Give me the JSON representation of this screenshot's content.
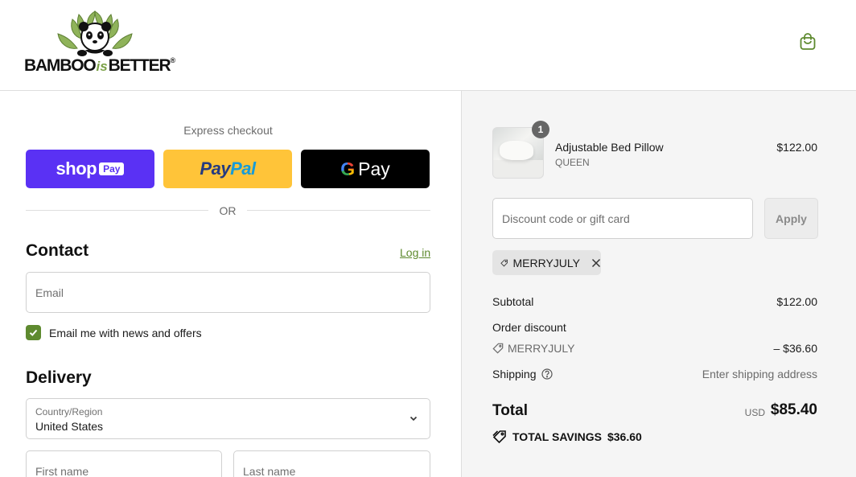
{
  "brand": {
    "name_part1": "BAMBOO",
    "name_part2": "is",
    "name_part3": "BETTER",
    "reg": "®"
  },
  "express": {
    "title": "Express checkout",
    "shop_label": "shop",
    "shop_pay_label": "Pay",
    "paypal_part1": "Pay",
    "paypal_part2": "Pal",
    "gpay_g": "G",
    "gpay_label": "Pay",
    "or_label": "OR"
  },
  "contact": {
    "title": "Contact",
    "login_label": "Log in",
    "email_placeholder": "Email",
    "newsletter_label": "Email me with news and offers",
    "newsletter_checked": true
  },
  "delivery": {
    "title": "Delivery",
    "country_label": "Country/Region",
    "country_value": "United States",
    "first_name_placeholder": "First name",
    "last_name_placeholder": "Last name"
  },
  "summary": {
    "item": {
      "quantity": "1",
      "name": "Adjustable Bed Pillow",
      "variant": "QUEEN",
      "price": "$122.00"
    },
    "discount_placeholder": "Discount code or gift card",
    "apply_label": "Apply",
    "applied_code": "MERRYJULY",
    "subtotal_label": "Subtotal",
    "subtotal_value": "$122.00",
    "order_discount_label": "Order discount",
    "order_discount_code": "MERRYJULY",
    "order_discount_value": "– $36.60",
    "shipping_label": "Shipping",
    "shipping_value": "Enter shipping address",
    "total_label": "Total",
    "total_currency": "USD",
    "total_value": "$85.40",
    "savings_label": "TOTAL SAVINGS",
    "savings_value": "$36.60"
  },
  "colors": {
    "accent": "#5e8a2f",
    "shop_pay": "#5a31f4",
    "paypal": "#ffc439",
    "gpay": "#000000",
    "summary_bg": "#f5f5f5"
  },
  "icons": [
    "panda-logo-icon",
    "shopping-bag-icon",
    "checkmark-icon",
    "chevron-down-icon",
    "tag-icon",
    "close-icon",
    "help-circle-icon",
    "savings-tag-icon"
  ]
}
